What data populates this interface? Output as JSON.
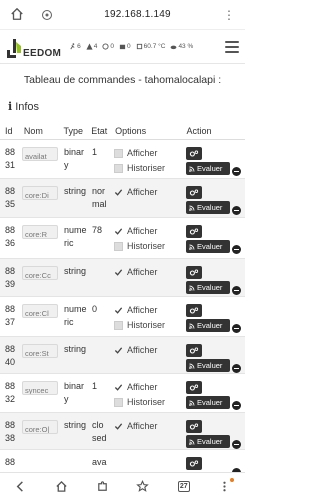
{
  "browser": {
    "url": "192.168.1.149"
  },
  "header": {
    "logo_text": "EEDOM",
    "status": [
      {
        "icon": "run-icon",
        "value": "6"
      },
      {
        "icon": "warning-icon",
        "value": "4"
      },
      {
        "icon": "sync-icon",
        "value": "0"
      },
      {
        "icon": "plugin-icon",
        "value": "0"
      },
      {
        "icon": "cpu-icon",
        "value": "60.7 °C"
      },
      {
        "icon": "cloud-icon",
        "value": "43 %"
      }
    ]
  },
  "page": {
    "title": "Tableau de commandes - tahomalocalapi :",
    "info_title": "Infos"
  },
  "table": {
    "headers": {
      "id": "Id",
      "nom": "Nom",
      "type": "Type",
      "etat": "Etat",
      "options": "Options",
      "action": "Action"
    },
    "option_labels": {
      "afficher": "Afficher",
      "historiser": "Historiser"
    },
    "action_labels": {
      "evaluer": "Evaluer"
    },
    "rows": [
      {
        "id_top": "88",
        "id_bottom": "31",
        "nom": "availat",
        "type_a": "binar",
        "type_b": "y",
        "etat_a": "1",
        "etat_b": "",
        "afficher": false,
        "historiser": false,
        "show_historiser": true
      },
      {
        "id_top": "88",
        "id_bottom": "35",
        "nom": "core:Di",
        "type_a": "string",
        "type_b": "",
        "etat_a": "nor",
        "etat_b": "mal",
        "afficher": true,
        "historiser": false,
        "show_historiser": false
      },
      {
        "id_top": "88",
        "id_bottom": "36",
        "nom": "core:R",
        "type_a": "nume",
        "type_b": "ric",
        "etat_a": "78",
        "etat_b": "",
        "afficher": true,
        "historiser": false,
        "show_historiser": true
      },
      {
        "id_top": "88",
        "id_bottom": "39",
        "nom": "core:Cc",
        "type_a": "string",
        "type_b": "",
        "etat_a": "",
        "etat_b": "",
        "afficher": true,
        "historiser": false,
        "show_historiser": false
      },
      {
        "id_top": "88",
        "id_bottom": "37",
        "nom": "core:Cl",
        "type_a": "nume",
        "type_b": "ric",
        "etat_a": "0",
        "etat_b": "",
        "afficher": true,
        "historiser": false,
        "show_historiser": true
      },
      {
        "id_top": "88",
        "id_bottom": "40",
        "nom": "core:St",
        "type_a": "string",
        "type_b": "",
        "etat_a": "",
        "etat_b": "",
        "afficher": true,
        "historiser": false,
        "show_historiser": false
      },
      {
        "id_top": "88",
        "id_bottom": "32",
        "nom": "syncec",
        "type_a": "binar",
        "type_b": "y",
        "etat_a": "1",
        "etat_b": "",
        "afficher": true,
        "historiser": false,
        "show_historiser": true
      },
      {
        "id_top": "88",
        "id_bottom": "38",
        "nom": "core:O|",
        "type_a": "string",
        "type_b": "",
        "etat_a": "clo",
        "etat_b": "sed",
        "afficher": true,
        "historiser": false,
        "show_historiser": false
      },
      {
        "id_top": "88",
        "id_bottom": "",
        "nom": "",
        "type_a": "",
        "type_b": "",
        "etat_a": "ava",
        "etat_b": "",
        "afficher": false,
        "historiser": false,
        "show_historiser": false
      }
    ]
  },
  "bottom_nav": {
    "tab_count": "27"
  },
  "colors": {
    "button_dark": "#333333",
    "striped_row": "#f3f3f3",
    "notification": "#e67e22"
  }
}
